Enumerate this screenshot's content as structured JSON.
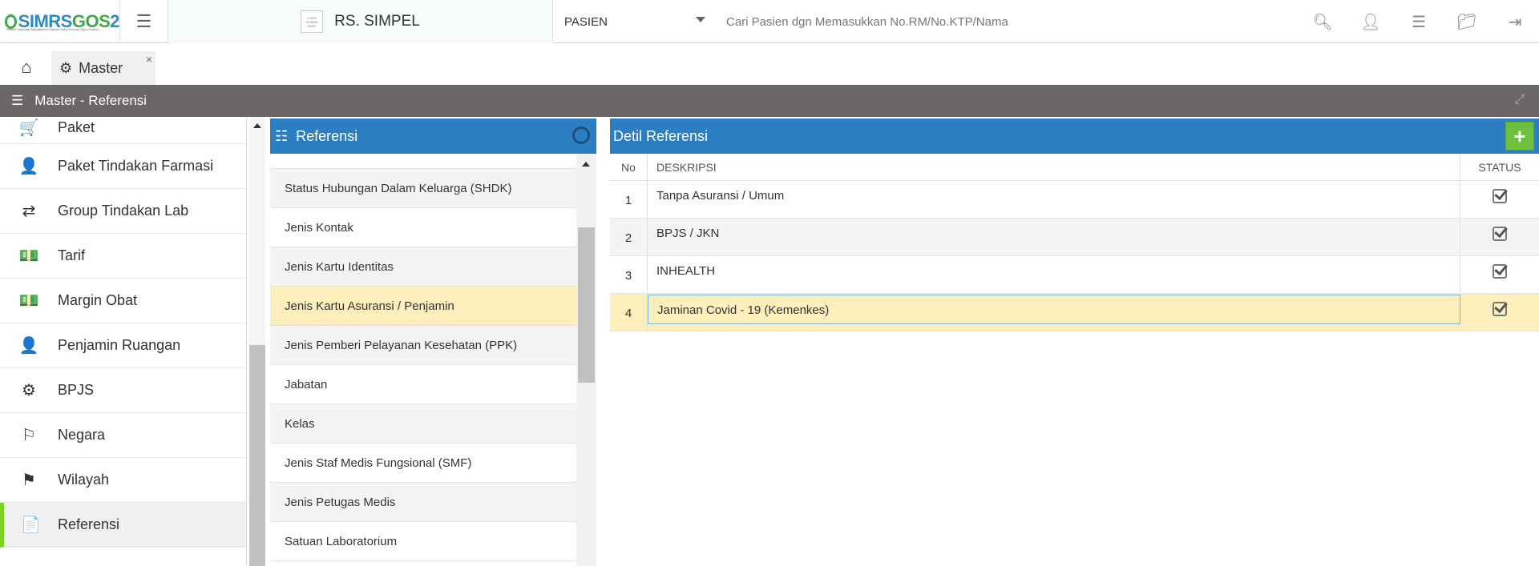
{
  "app": {
    "brand_part1": "SIMRS",
    "brand_part2": "GOS",
    "brand_part3": "2",
    "tagline": "Sistem Informasi Manajemen Rumah Sakit Generik Open Source",
    "hospital_logo_text": "LOGO RUMAH SAKIT",
    "hospital_name": "RS. SIMPEL"
  },
  "search": {
    "category": "PASIEN",
    "placeholder": "Cari Pasien dgn Memasukkan No.RM/No.KTP/Nama"
  },
  "tabs": {
    "master_label": "Master",
    "close": "×"
  },
  "page_title": "Master - Referensi",
  "sidebar": {
    "items": [
      {
        "label": "Paket",
        "icon": "cart-icon",
        "glyph": "🛒"
      },
      {
        "label": "Paket Tindakan Farmasi",
        "icon": "user-secret-icon",
        "glyph": "👤"
      },
      {
        "label": "Group Tindakan Lab",
        "icon": "exchange-icon",
        "glyph": "⇄"
      },
      {
        "label": "Tarif",
        "icon": "money-icon",
        "glyph": "💵"
      },
      {
        "label": "Margin Obat",
        "icon": "money-icon",
        "glyph": "💵"
      },
      {
        "label": "Penjamin Ruangan",
        "icon": "user-secret-icon",
        "glyph": "👤"
      },
      {
        "label": "BPJS",
        "icon": "life-ring-icon",
        "glyph": "⚙"
      },
      {
        "label": "Negara",
        "icon": "flag-icon",
        "glyph": "⚐"
      },
      {
        "label": "Wilayah",
        "icon": "flag-checkered-icon",
        "glyph": "⚑"
      },
      {
        "label": "Referensi",
        "icon": "file-icon",
        "glyph": "📄"
      }
    ]
  },
  "referensi": {
    "title": "Referensi",
    "items": [
      "Status Hubungan Dalam Keluarga (SHDK)",
      "Jenis Kontak",
      "Jenis Kartu Identitas",
      "Jenis Kartu Asuransi / Penjamin",
      "Jenis Pemberi Pelayanan Kesehatan (PPK)",
      "Jabatan",
      "Kelas",
      "Jenis Staf Medis Fungsional (SMF)",
      "Jenis Petugas Medis",
      "Satuan Laboratorium"
    ],
    "selected": "Jenis Kartu Asuransi / Penjamin"
  },
  "detail": {
    "title": "Detil Referensi",
    "add_label": "+",
    "columns": {
      "no": "No",
      "desc": "DESKRIPSI",
      "status": "STATUS"
    },
    "rows": [
      {
        "no": "1",
        "desc": "Tanpa Asuransi / Umum",
        "status": true
      },
      {
        "no": "2",
        "desc": "BPJS / JKN",
        "status": true
      },
      {
        "no": "3",
        "desc": "INHEALTH",
        "status": true
      },
      {
        "no": "4",
        "desc": "Jaminan Covid - 19 (Kemenkes)",
        "status": true
      }
    ]
  }
}
